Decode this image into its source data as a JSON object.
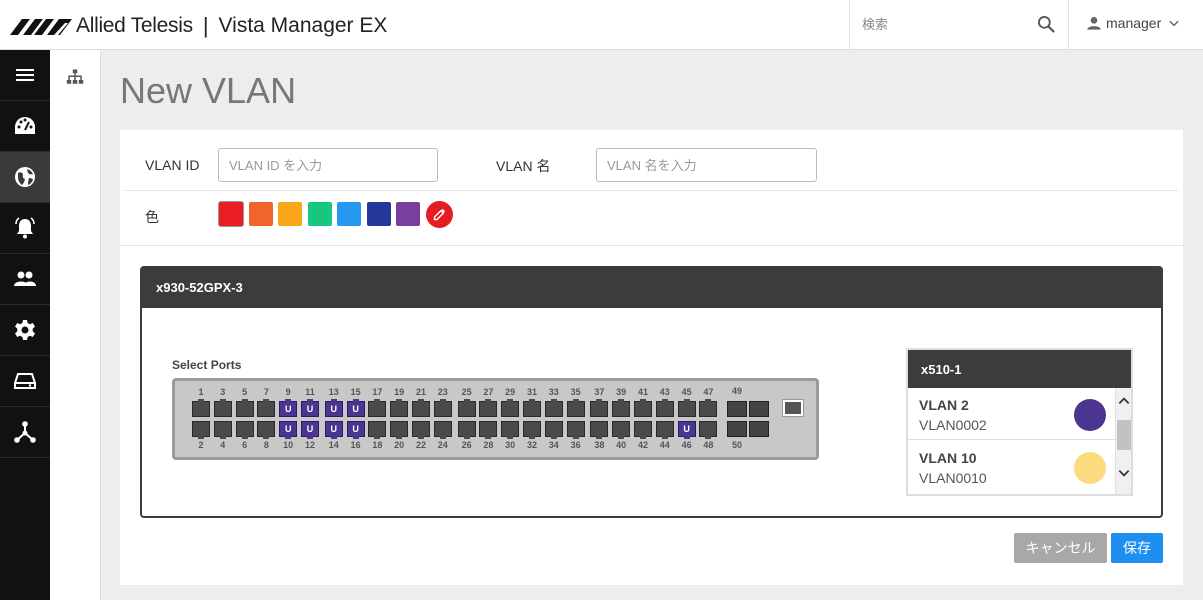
{
  "header": {
    "brand": "Allied Telesis",
    "product": "Vista Manager EX",
    "search_placeholder": "検索",
    "user": "manager"
  },
  "sidebar": {
    "items": [
      {
        "icon": "menu-icon"
      },
      {
        "icon": "dashboard-icon"
      },
      {
        "icon": "globe-icon",
        "active": true
      },
      {
        "icon": "alarm-icon"
      },
      {
        "icon": "users-icon"
      },
      {
        "icon": "gear-icon"
      },
      {
        "icon": "storage-icon"
      },
      {
        "icon": "topology-icon"
      }
    ],
    "sub_icon": "sitemap-icon"
  },
  "page": {
    "title": "New VLAN",
    "vlan_id_label": "VLAN ID",
    "vlan_id_placeholder": "VLAN ID を入力",
    "vlan_name_label": "VLAN 名",
    "vlan_name_placeholder": "VLAN 名を入力",
    "color_label": "色",
    "colors": [
      "#ea1c24",
      "#f0652b",
      "#fba618",
      "#18c67d",
      "#2698f0",
      "#25389a",
      "#7a3e9c"
    ],
    "selected_color": 0,
    "picker_color": "#e51c23"
  },
  "device": {
    "name": "x930-52GPX-3",
    "select_ports_label": "Select Ports",
    "top_ports": [
      "1",
      "3",
      "5",
      "7",
      "9",
      "11",
      "13",
      "15",
      "17",
      "19",
      "21",
      "23",
      "25",
      "27",
      "29",
      "31",
      "33",
      "35",
      "37",
      "39",
      "41",
      "43",
      "45",
      "47"
    ],
    "bottom_ports": [
      "2",
      "4",
      "6",
      "8",
      "10",
      "12",
      "14",
      "16",
      "18",
      "20",
      "22",
      "24",
      "26",
      "28",
      "30",
      "32",
      "34",
      "36",
      "38",
      "40",
      "42",
      "44",
      "46",
      "48"
    ],
    "untagged_ports": [
      "9",
      "10",
      "11",
      "12",
      "13",
      "14",
      "15",
      "16",
      "46"
    ],
    "untagged_mark": "U",
    "sfp_top_label": "49",
    "sfp_bottom_label": "50"
  },
  "vlan_list": {
    "title": "x510-1",
    "items": [
      {
        "name": "VLAN 2",
        "id": "VLAN0002",
        "color": "#4b3590"
      },
      {
        "name": "VLAN 10",
        "id": "VLAN0010",
        "color": "#fcdb7e"
      }
    ]
  },
  "buttons": {
    "cancel": "キャンセル",
    "save": "保存"
  }
}
